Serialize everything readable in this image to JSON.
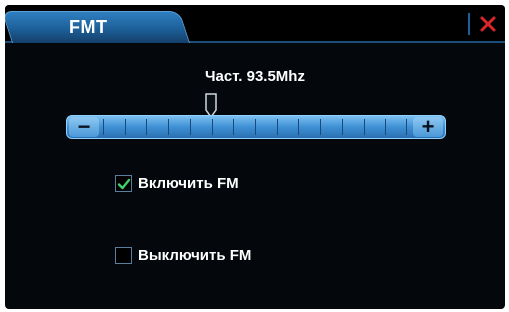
{
  "window": {
    "tab_title": "FMT",
    "close_icon": "close-x-icon",
    "close_color": "#d9262b"
  },
  "frequency": {
    "label": "Част. 93.5Mhz"
  },
  "slider": {
    "minus_label": "−",
    "plus_label": "+",
    "segments": 14,
    "position": 0.36,
    "accent_color": "#3f90d4"
  },
  "options": [
    {
      "label": "Включить FM",
      "checked": true
    },
    {
      "label": "Выключить FM",
      "checked": false
    }
  ]
}
